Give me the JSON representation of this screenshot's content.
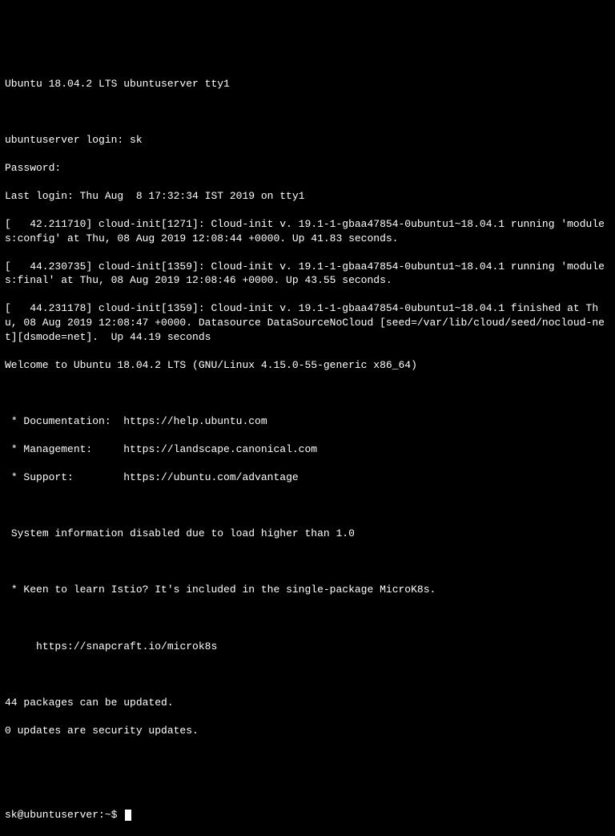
{
  "header": "Ubuntu 18.04.2 LTS ubuntuserver tty1",
  "login_prompt": "ubuntuserver login: sk",
  "password_prompt": "Password:",
  "last_login": "Last login: Thu Aug  8 17:32:34 IST 2019 on tty1",
  "cloud_init_1": "[   42.211710] cloud-init[1271]: Cloud-init v. 19.1-1-gbaa47854-0ubuntu1~18.04.1 running 'modules:config' at Thu, 08 Aug 2019 12:08:44 +0000. Up 41.83 seconds.",
  "cloud_init_2": "[   44.230735] cloud-init[1359]: Cloud-init v. 19.1-1-gbaa47854-0ubuntu1~18.04.1 running 'modules:final' at Thu, 08 Aug 2019 12:08:46 +0000. Up 43.55 seconds.",
  "cloud_init_3": "[   44.231178] cloud-init[1359]: Cloud-init v. 19.1-1-gbaa47854-0ubuntu1~18.04.1 finished at Thu, 08 Aug 2019 12:08:47 +0000. Datasource DataSourceNoCloud [seed=/var/lib/cloud/seed/nocloud-net][dsmode=net].  Up 44.19 seconds",
  "welcome": "Welcome to Ubuntu 18.04.2 LTS (GNU/Linux 4.15.0-55-generic x86_64)",
  "doc_line": " * Documentation:  https://help.ubuntu.com",
  "mgmt_line": " * Management:     https://landscape.canonical.com",
  "support_line": " * Support:        https://ubuntu.com/advantage",
  "sysinfo": " System information disabled due to load higher than 1.0",
  "istio": " * Keen to learn Istio? It's included in the single-package MicroK8s.",
  "microk8s_url": "     https://snapcraft.io/microk8s",
  "pkg_update": "44 packages can be updated.",
  "sec_update": "0 updates are security updates.",
  "prompt": "sk@ubuntuserver:~$ "
}
